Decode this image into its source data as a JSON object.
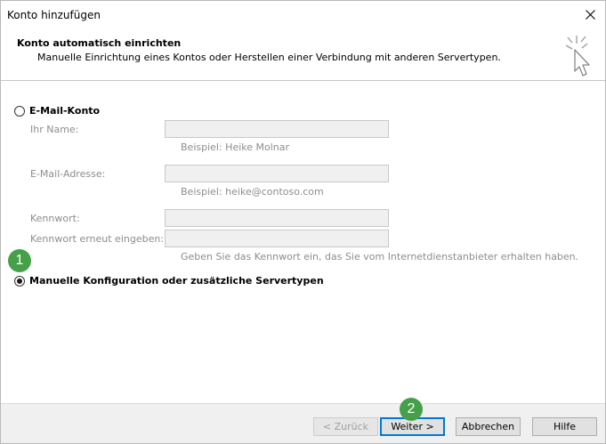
{
  "window": {
    "title": "Konto hinzufügen"
  },
  "header": {
    "title": "Konto automatisch einrichten",
    "subtitle": "Manuelle Einrichtung eines Kontos oder Herstellen einer Verbindung mit anderen Servertypen."
  },
  "email_account": {
    "label": "E-Mail-Konto",
    "name_label": "Ihr Name:",
    "name_value": "",
    "name_hint": "Beispiel: Heike Molnar",
    "email_label": "E-Mail-Adresse:",
    "email_value": "",
    "email_hint": "Beispiel: heike@contoso.com",
    "password_label": "Kennwort:",
    "password_value": "",
    "password_repeat_label": "Kennwort erneut eingeben:",
    "password_repeat_value": "",
    "password_hint": "Geben Sie das Kennwort ein, das Sie vom Internetdienstanbieter erhalten haben."
  },
  "manual": {
    "label": "Manuelle Konfiguration oder zusätzliche Servertypen"
  },
  "badges": {
    "one": "1",
    "two": "2"
  },
  "buttons": {
    "back": "< Zurück",
    "next": "Weiter >",
    "cancel": "Abbrechen",
    "help": "Hilfe"
  },
  "colors": {
    "accent": "#0078d7",
    "badge": "#46a049"
  }
}
